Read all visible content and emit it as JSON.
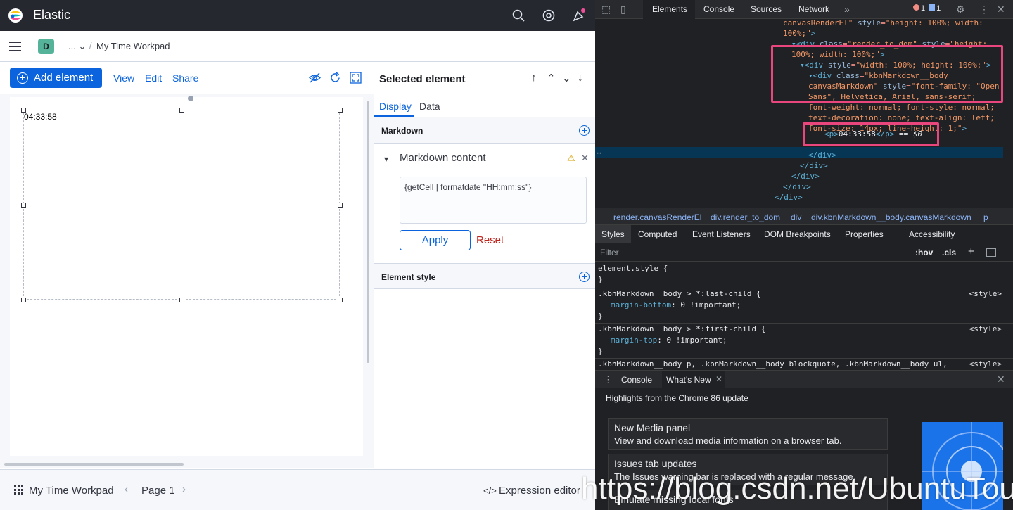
{
  "app": {
    "brand": "Elastic",
    "space_initial": "D",
    "breadcrumb_ellipsis": "... ",
    "breadcrumb_sep": "/",
    "workpad_title": "My Time Workpad"
  },
  "toolbar": {
    "add_element_label": "Add element",
    "view_label": "View",
    "edit_label": "Edit",
    "share_label": "Share"
  },
  "canvas": {
    "element_text": "04:33:58"
  },
  "sidebar": {
    "title": "Selected element",
    "tabs": [
      "Display",
      "Data"
    ],
    "markdown_section": "Markdown",
    "markdown_content_title": "Markdown content",
    "markdown_expression": "{getCell | formatdate \"HH:mm:ss\"}",
    "apply_label": "Apply",
    "reset_label": "Reset",
    "element_style_section": "Element style"
  },
  "footer": {
    "workpad_title": "My Time Workpad",
    "page_label": "Page 1",
    "expression_editor_label": "Expression editor"
  },
  "devtools": {
    "tabs": [
      "Elements",
      "Console",
      "Sources",
      "Network"
    ],
    "error_count": "1",
    "message_count": "1",
    "dom_selected_text": "04:33:58",
    "dom_selected_suffix": " == $0",
    "breadcrumbs": [
      "render.canvasRenderEl",
      "div.render_to_dom",
      "div",
      "div.kbnMarkdown__body.canvasMarkdown",
      "p"
    ],
    "style_tabs": [
      "Styles",
      "Computed",
      "Event Listeners",
      "DOM Breakpoints",
      "Properties",
      "Accessibility"
    ],
    "filter_placeholder": "Filter",
    "hov_label": ":hov",
    "cls_label": ".cls",
    "style_source": "<style>",
    "drawer_tabs": [
      "Console",
      "What's New"
    ],
    "whats_new_heading": "Highlights from the Chrome 86 update",
    "whats_new_cards": [
      {
        "title": "New Media panel",
        "desc": "View and download media information on a browser tab."
      },
      {
        "title": "Issues tab updates",
        "desc": "The Issues warning bar is replaced with a regular message."
      },
      {
        "title": "Emulate missing local fonts",
        "desc": ""
      }
    ]
  },
  "watermark": "https://blog.csdn.net/UbuntuTouch",
  "colors": {
    "accent": "#0b64dd",
    "header_bg": "#25282f",
    "devtools_bg": "#202124",
    "highlight_box": "#e8467c"
  }
}
